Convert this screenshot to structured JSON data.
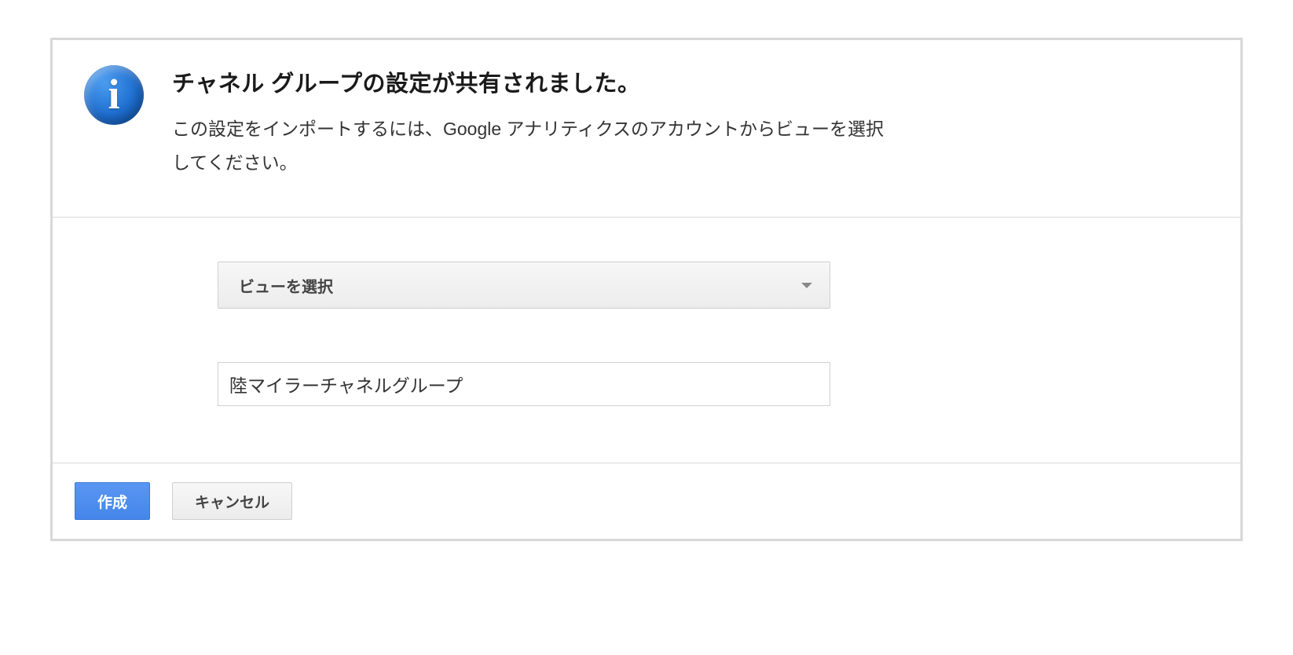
{
  "header": {
    "title": "チャネル グループの設定が共有されました。",
    "subtitle": "この設定をインポートするには、Google アナリティクスのアカウントからビューを選択してください。"
  },
  "form": {
    "view_select_label": "ビューを選択",
    "name_input_value": "陸マイラーチャネルグループ"
  },
  "footer": {
    "create_label": "作成",
    "cancel_label": "キャンセル"
  }
}
